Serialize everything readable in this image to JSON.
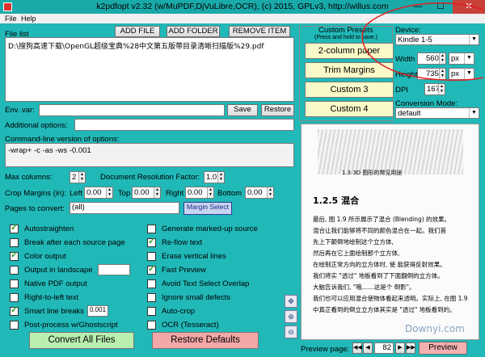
{
  "window": {
    "title": "k2pdfopt v2.32 (w/MuPDF,DjVuLibre,OCR), (c) 2015, GPLv3, http://willus.com",
    "min": "—",
    "max": "☐",
    "close": "✕"
  },
  "menu": {
    "file": "File",
    "help": "Help"
  },
  "file_list": {
    "label": "File list",
    "add_file": "ADD FILE",
    "add_folder": "ADD FOLDER",
    "remove_item": "REMOVE ITEM",
    "items": [
      "D:\\搜狗高速下载\\OpenGL超级宝典%28中文第五版带目录清晰扫描版%29.pdf"
    ]
  },
  "env": {
    "label": "Env. var:",
    "value": "",
    "save": "Save",
    "restore": "Restore"
  },
  "addl": {
    "label": "Additional options:",
    "value": ""
  },
  "cmdline": {
    "label": "Command-line version of options:",
    "value": "-wrap+ -c -as -ws -0.001"
  },
  "max_columns": {
    "label": "Max columns:",
    "value": "2"
  },
  "doc_res": {
    "label": "Document Resolution Factor:",
    "value": "1.0"
  },
  "crop": {
    "label": "Crop Margins (in):",
    "left_label": "Left",
    "left": "0.00",
    "top_label": "Top",
    "top": "0.00",
    "right_label": "Right",
    "right": "0.00",
    "bottom_label": "Bottom",
    "bottom": "0.00"
  },
  "pages": {
    "label": "Pages to convert:",
    "value": "(all)",
    "margin_select": "Margin Select"
  },
  "options_left": [
    {
      "label": "Autostraighten",
      "checked": true
    },
    {
      "label": "Break after each source page",
      "checked": false
    },
    {
      "label": "Color output",
      "checked": true
    },
    {
      "label": "Output in landscape",
      "checked": false
    },
    {
      "label": "Native PDF output",
      "checked": false
    },
    {
      "label": "Right-to-left text",
      "checked": false
    },
    {
      "label": "Smart line breaks",
      "checked": true,
      "extra": "0.001"
    },
    {
      "label": "Post-process w/Ghostscript",
      "checked": false
    }
  ],
  "options_right": [
    {
      "label": "Generate marked-up source",
      "checked": false
    },
    {
      "label": "Re-flow text",
      "checked": true
    },
    {
      "label": "Erase vertical lines",
      "checked": false
    },
    {
      "label": "Fast Preview",
      "checked": true
    },
    {
      "label": "Avoid Text Select Overlap",
      "checked": false
    },
    {
      "label": "Ignore small defects",
      "checked": false
    },
    {
      "label": "Auto-crop",
      "checked": false
    },
    {
      "label": "OCR (Tesseract)",
      "checked": false
    }
  ],
  "presets": {
    "label": "Custom Presets",
    "hint": "(Press and hold to save.)",
    "items": [
      "2-column paper",
      "Trim Margins",
      "Custom 3",
      "Custom 4"
    ]
  },
  "device": {
    "label": "Device:",
    "value": "Kindle 1-5",
    "width_label": "Width",
    "width": "560",
    "width_unit": "px",
    "height_label": "Height",
    "height": "735",
    "height_unit": "px",
    "dpi_label": "DPI",
    "dpi": "167"
  },
  "conversion": {
    "label": "Conversion Mode:",
    "value": "default"
  },
  "preview_page": {
    "fig_caption": "1.3  3D 图形的常见用途",
    "heading": "1.2.5   混合",
    "lines": [
      "最后, 图 1.9 所示展示了混合 (Blending) 的效果。",
      "混合让我们能够将不同的颜色混合在一起。我们首",
      "先上下颠倒地绘制这个立方体,",
      "然后再在它上面绘制那个立方体,",
      "在绘制正常方向的立方体时, 使 能获得反射效果。",
      "我们将实 \"透过\" 地板看到了下面翻倒的立方体。",
      "大脑告诉我们, \"哦……这是个 倒影\"。",
      "我们也可以应用混合使物体看起来透明。实际上, 在图 1.9",
      "中真正看到的倒立立方体其实是 \"透过\" 地板看到的。"
    ],
    "watermark": "Downyi.com"
  },
  "bottom": {
    "convert": "Convert All Files",
    "restore": "Restore Defaults",
    "preview_label": "Preview page:",
    "page": "82",
    "preview": "Preview"
  },
  "colors": {
    "accent": "#21b8b8",
    "convert_bg": "#b9f0b0",
    "restore_bg": "#f4a7a7",
    "preset_bg": "#fafac8"
  }
}
